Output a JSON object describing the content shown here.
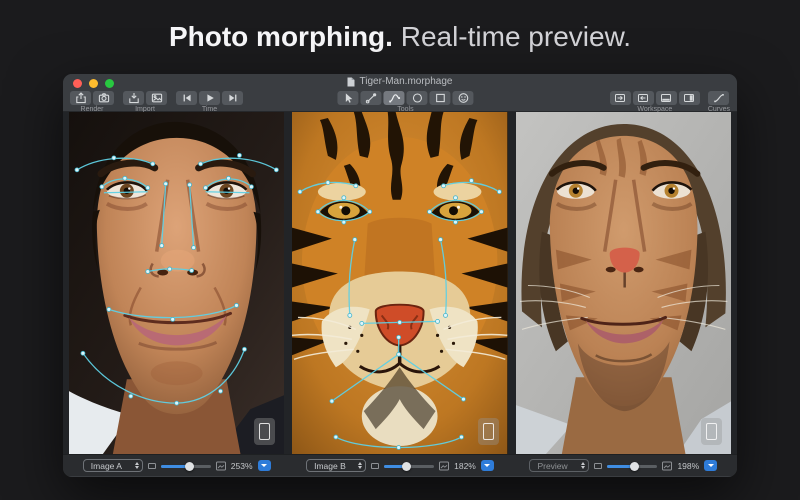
{
  "banner": {
    "bold": "Photo morphing.",
    "regular": " Real-time preview."
  },
  "window": {
    "title": "Tiger-Man.morphage",
    "traffic_lights": {
      "close": "#ff5f57",
      "minimize": "#febc2e",
      "zoom": "#28c840"
    },
    "toolbar": {
      "render": {
        "label": "Render",
        "buttons": [
          "export-icon",
          "render-camera-icon"
        ]
      },
      "import": {
        "label": "Import",
        "buttons": [
          "import-tray-icon",
          "add-image-icon"
        ]
      },
      "time": {
        "label": "Time",
        "buttons": [
          "skip-back-icon",
          "play-icon",
          "skip-forward-icon"
        ]
      },
      "tools": {
        "label": "Tools",
        "buttons": [
          "cursor-icon",
          "node-icon",
          "curve-icon",
          "ellipse-icon",
          "rectangle-icon",
          "face-icon"
        ],
        "selected": "curve-icon"
      },
      "workspace": {
        "label": "Workspace",
        "buttons": [
          "expand-right-icon",
          "expand-left-icon",
          "bottom-pane-icon",
          "right-pane-icon"
        ]
      },
      "curves": {
        "label": "Curves",
        "buttons": [
          "curves-graph-icon"
        ]
      }
    },
    "panels": [
      {
        "popup_value": "Image A",
        "zoom_value": "253%",
        "slider_percent": 58,
        "content": "man-portrait-with-morph-points"
      },
      {
        "popup_value": "Image B",
        "zoom_value": "182%",
        "slider_percent": 45,
        "content": "tiger-portrait-with-morph-points"
      },
      {
        "popup_value": "Preview",
        "zoom_value": "198%",
        "slider_percent": 55,
        "content": "morphed-tiger-man-preview"
      }
    ],
    "colors": {
      "accent_blue": "#2e7cd9",
      "control_point_cyan": "#5fd0e4",
      "chrome": "#3a3d41",
      "canvas_bg": "#222427"
    }
  }
}
